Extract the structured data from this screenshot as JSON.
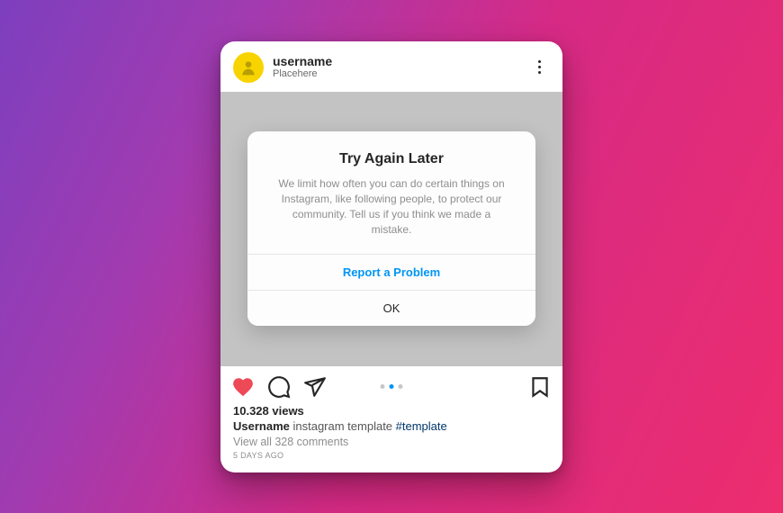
{
  "header": {
    "username": "username",
    "location": "Placehere"
  },
  "dialog": {
    "title": "Try Again Later",
    "message": "We limit how often you can do certain things on Instagram, like following people, to protect our community. Tell us if you think we made a mistake.",
    "primary_action": "Report a Problem",
    "secondary_action": "OK"
  },
  "carousel": {
    "total": 3,
    "active": 1
  },
  "meta": {
    "views": "10.328 views",
    "caption_username": "Username",
    "caption_text": " instagram template ",
    "caption_hashtag": "#template",
    "view_comments": "View all 328 comments",
    "time_ago": "5 DAYS AGO"
  },
  "icons": {
    "more": "more-icon",
    "heart": "heart-icon",
    "comment": "comment-icon",
    "share": "share-icon",
    "bookmark": "bookmark-icon",
    "avatar_placeholder": "user-icon"
  },
  "colors": {
    "accent_blue": "#0095f6",
    "heart_red": "#ed4956",
    "avatar_yellow": "#f7d400",
    "bg_gradient_start": "#7d3fbe",
    "bg_gradient_end": "#ed2d6e"
  }
}
